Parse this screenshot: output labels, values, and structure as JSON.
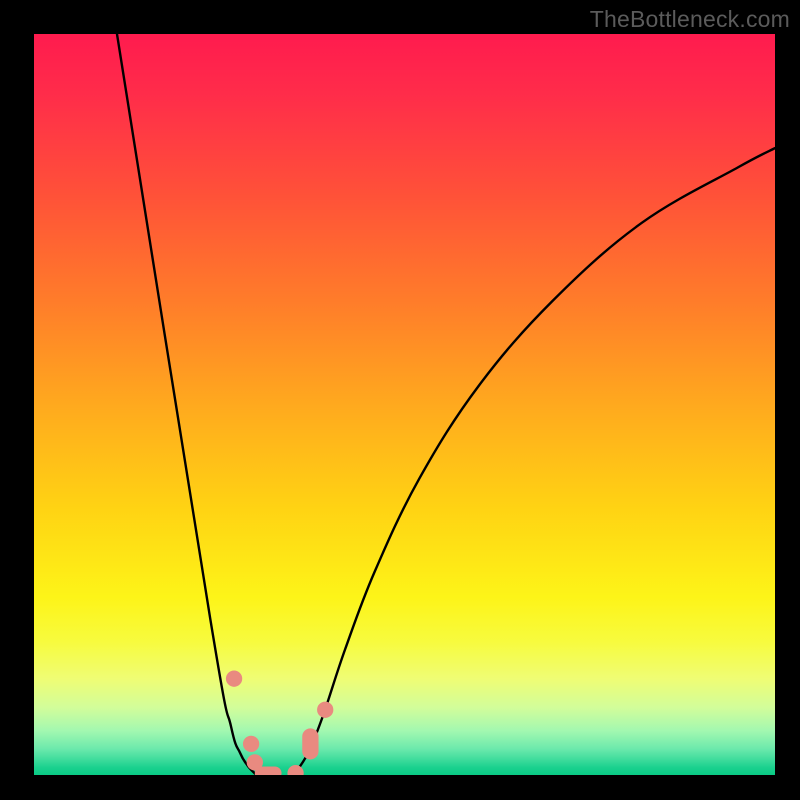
{
  "watermark": "TheBottleneck.com",
  "colors": {
    "frame": "#000000",
    "curve": "#000000",
    "marker_fill": "#e98a80",
    "marker_stroke": "#d77668"
  },
  "chart_data": {
    "type": "line",
    "title": "",
    "xlabel": "",
    "ylabel": "",
    "xlim": [
      0,
      100
    ],
    "ylim": [
      0,
      100
    ],
    "series": [
      {
        "name": "left-branch",
        "x": [
          11.2,
          23.8,
          26.6,
          27.8,
          28.8,
          29.8
        ],
        "y": [
          100,
          21.0,
          6.5,
          3.0,
          1.3,
          0.2
        ]
      },
      {
        "name": "right-branch",
        "x": [
          35.2,
          37.0,
          39.0,
          42.0,
          46.0,
          52.0,
          60.0,
          70.0,
          82.0,
          95.0,
          100.0
        ],
        "y": [
          0.2,
          3.0,
          8.0,
          17.0,
          27.5,
          40.0,
          52.5,
          64.0,
          74.5,
          82.0,
          84.6
        ]
      }
    ],
    "markers": [
      {
        "shape": "round",
        "x": 27.0,
        "y": 13.0,
        "r": 1.1
      },
      {
        "shape": "round",
        "x": 29.3,
        "y": 4.2,
        "r": 1.1
      },
      {
        "shape": "round",
        "x": 29.8,
        "y": 1.7,
        "r": 1.1
      },
      {
        "shape": "pill",
        "x": 31.6,
        "y": 0.25,
        "w": 3.6,
        "h": 1.8
      },
      {
        "shape": "round",
        "x": 35.3,
        "y": 0.25,
        "r": 1.1
      },
      {
        "shape": "pill-vert",
        "x": 37.3,
        "y": 4.2,
        "w": 2.2,
        "h": 4.2
      },
      {
        "shape": "round",
        "x": 39.3,
        "y": 8.8,
        "r": 1.1
      }
    ]
  }
}
